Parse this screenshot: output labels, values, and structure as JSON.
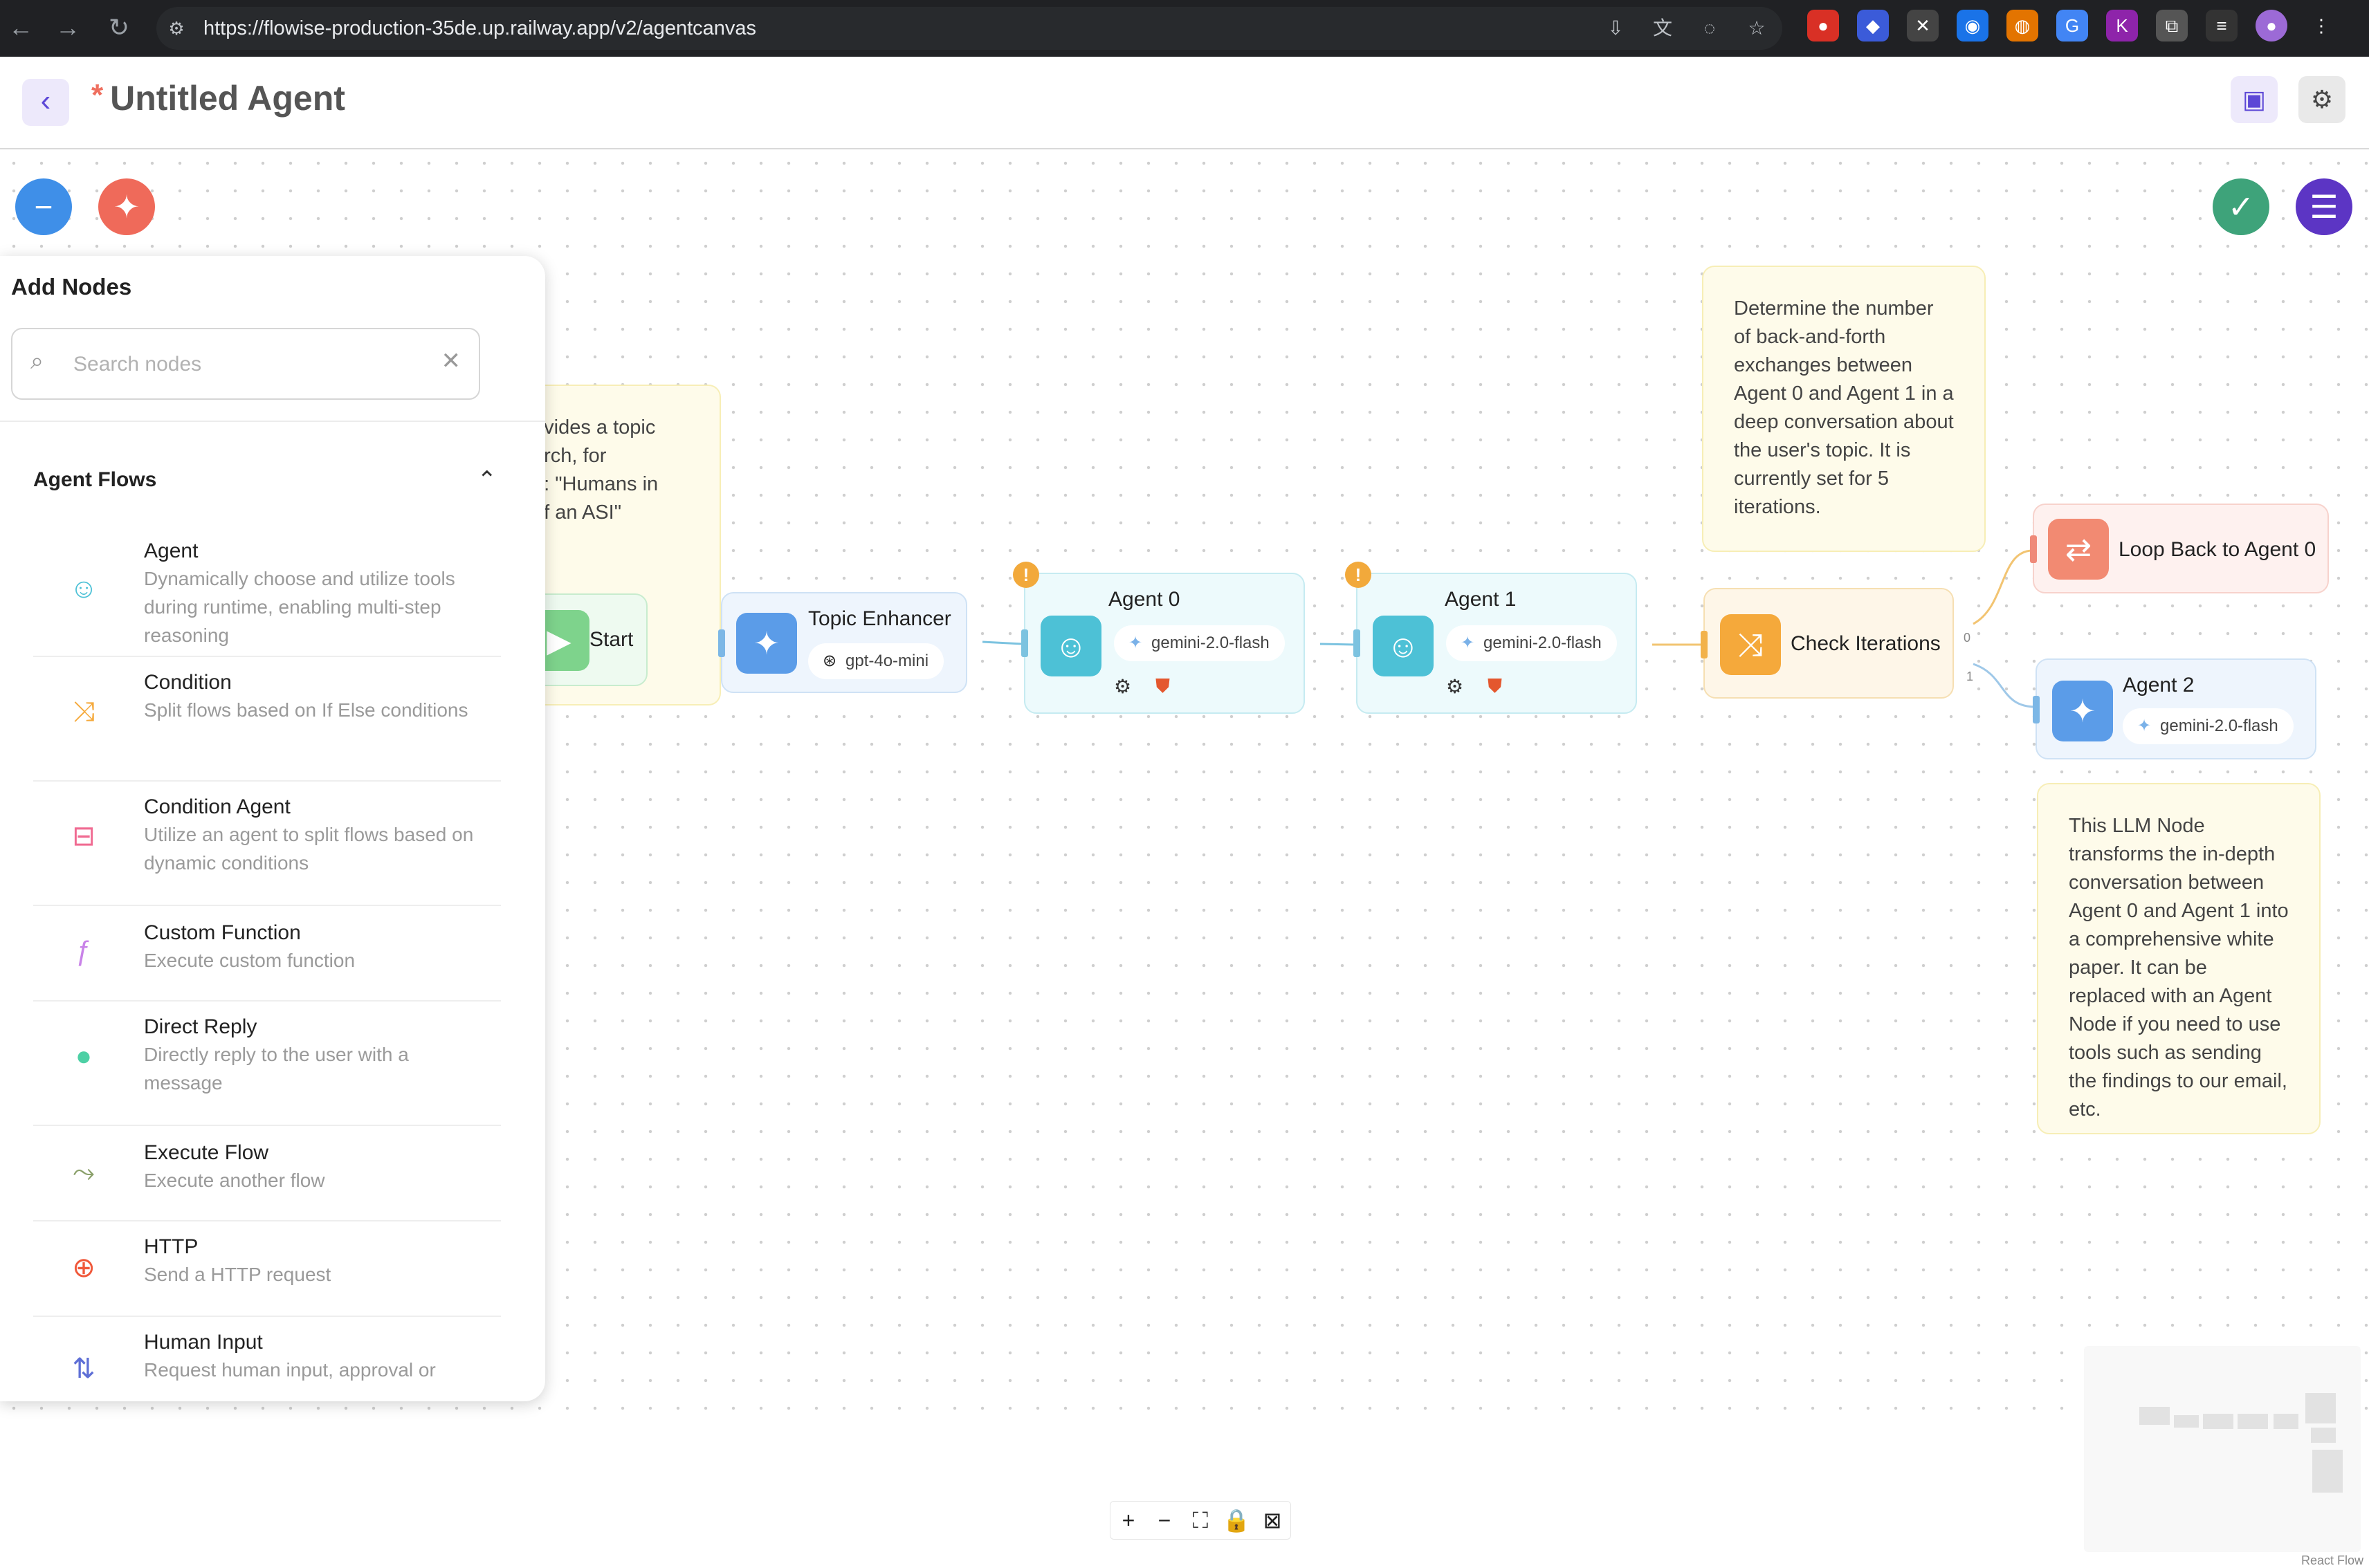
{
  "browser": {
    "url": "https://flowise-production-35de.up.railway.app/v2/agentcanvas"
  },
  "header": {
    "unsaved_marker": "*",
    "title": "Untitled Agent"
  },
  "panel": {
    "title": "Add Nodes",
    "search_placeholder": "Search nodes",
    "group_label": "Agent Flows",
    "items": [
      {
        "name": "Agent",
        "desc": "Dynamically choose and utilize tools during runtime, enabling multi-step reasoning",
        "icon": "robot-icon",
        "color": "#4dc1d6"
      },
      {
        "name": "Condition",
        "desc": "Split flows based on If Else conditions",
        "icon": "split-icon",
        "color": "#f5a93b"
      },
      {
        "name": "Condition Agent",
        "desc": "Utilize an agent to split flows based on dynamic conditions",
        "icon": "tree-icon",
        "color": "#f06b92"
      },
      {
        "name": "Custom Function",
        "desc": "Execute custom function",
        "icon": "function-icon",
        "color": "#c983e8"
      },
      {
        "name": "Direct Reply",
        "desc": "Directly reply to the user with a message",
        "icon": "chat-bubble-icon",
        "color": "#4dd0a5"
      },
      {
        "name": "Execute Flow",
        "desc": "Execute another flow",
        "icon": "flow-icon",
        "color": "#8aa06a"
      },
      {
        "name": "HTTP",
        "desc": "Send a HTTP request",
        "icon": "globe-icon",
        "color": "#f0583a"
      },
      {
        "name": "Human Input",
        "desc": "Request human input, approval or",
        "icon": "human-input-icon",
        "color": "#5e6fd6"
      }
    ]
  },
  "canvas": {
    "nodes": {
      "start": {
        "title": "Start"
      },
      "topic_enhancer": {
        "title": "Topic Enhancer",
        "model": "gpt-4o-mini"
      },
      "agent0": {
        "title": "Agent 0",
        "model": "gemini-2.0-flash",
        "warning": "!"
      },
      "agent1": {
        "title": "Agent 1",
        "model": "gemini-2.0-flash",
        "warning": "!"
      },
      "check_iterations": {
        "title": "Check Iterations"
      },
      "loop_back": {
        "title": "Loop Back to Agent 0"
      },
      "agent2": {
        "title": "Agent 2",
        "model": "gemini-2.0-flash"
      }
    },
    "edge_labels": {
      "out0": "0",
      "out1": "1"
    },
    "sticky_notes": {
      "topic": "ovides a topic\narch, for\ne: \"Humans in\nof an ASI\"",
      "iterations": "Determine the number of back-and-forth exchanges between Agent 0 and Agent 1 in a deep conversation about the user's topic. It is currently set for 5 iterations.",
      "llm": "This LLM Node transforms the in-depth conversation between Agent 0 and Agent 1 into a comprehensive white paper. It can be replaced with an Agent Node if you need to use tools such as sending the findings to our email, etc."
    },
    "attribution": "React Flow"
  },
  "colors": {
    "accent": "#5c47d6",
    "fab_blue": "#3f8fe8",
    "fab_coral": "#ef6a5a",
    "fab_green": "#3ea37a",
    "fab_purple": "#5c35c4"
  }
}
